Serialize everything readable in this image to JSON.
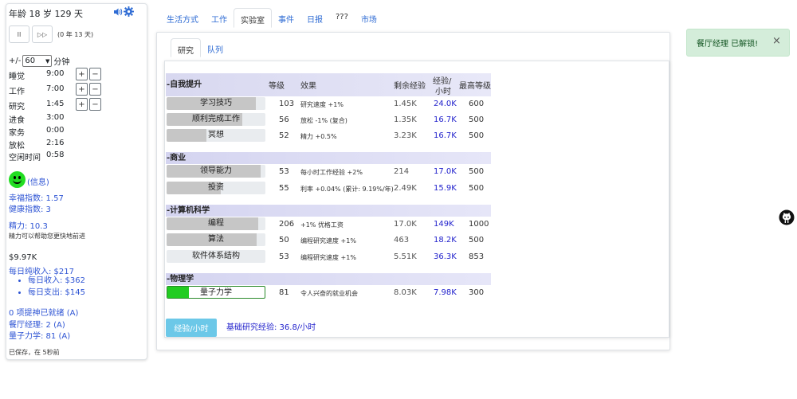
{
  "sidebar": {
    "age": "年龄 18 岁 129 天",
    "sound_icon": "speaker-icon",
    "settings_icon": "gear-icon",
    "pause_label": "II",
    "ff_label": "▷▷",
    "years_days": "(0 年 13 天)",
    "plus_minus": "+/-",
    "minutes_select": "60",
    "minutes_unit": "分钟",
    "schedule": [
      {
        "label": "睡觉",
        "value": "9:00",
        "adjustable": true
      },
      {
        "label": "工作",
        "value": "7:00",
        "adjustable": true
      },
      {
        "label": "研究",
        "value": "1:45",
        "adjustable": true
      },
      {
        "label": "进食",
        "value": "3:00",
        "adjustable": false
      },
      {
        "label": "家务",
        "value": "0:00",
        "adjustable": false
      },
      {
        "label": "放松",
        "value": "2:16",
        "adjustable": false
      },
      {
        "label": "空闲时间",
        "value": "0:58",
        "adjustable": false
      }
    ],
    "plus": "+",
    "minus": "−",
    "info_link": "(信息)",
    "happiness": "幸福指数: 1.57",
    "health": "健康指数: 3",
    "energy": "精力: 10.3",
    "energy_note": "精力可以帮助您更快地前进",
    "money": "$9.97K",
    "daily_net": "每日纯收入: $217",
    "daily_income": "每日收入: $362",
    "daily_expense": "每日支出: $145",
    "ready": "0 项提神已就绪 (A)",
    "restaurant_manager": "餐厅经理: 2 (A)",
    "quantum": "量子力学: 81 (A)",
    "saved": "已保存，在 5秒前"
  },
  "nav": {
    "tabs": [
      "生活方式",
      "工作",
      "实验室",
      "事件",
      "日报",
      "???",
      "市场"
    ],
    "active": "实验室"
  },
  "subnav": {
    "tabs": [
      "研究",
      "队列"
    ],
    "active": "研究"
  },
  "table": {
    "headers": {
      "level": "等级",
      "effect": "效果",
      "remaining": "剩余经验",
      "xph_line1": "经验/",
      "xph_line2": "小时",
      "max": "最高等级"
    },
    "sections": [
      {
        "title": "-自我提升",
        "rows": [
          {
            "name": "学习技巧",
            "progress": 0.9,
            "level": "103",
            "effect": "研究速度 +1%",
            "remaining": "1.45K",
            "xph": "24.0K",
            "max": "600"
          },
          {
            "name": "顺利完成工作",
            "progress": 0.77,
            "level": "56",
            "effect": "放松 -1% (复合)",
            "remaining": "1.35K",
            "xph": "16.7K",
            "max": "500"
          },
          {
            "name": "冥想",
            "progress": 0.4,
            "level": "52",
            "effect": "精力 +0.5%",
            "remaining": "3.23K",
            "xph": "16.7K",
            "max": "500"
          }
        ]
      },
      {
        "title": "-商业",
        "rows": [
          {
            "name": "领导能力",
            "progress": 0.95,
            "level": "53",
            "effect": "每小时工作经验 +2%",
            "remaining": "214",
            "xph": "17.0K",
            "max": "500"
          },
          {
            "name": "投资",
            "progress": 0.55,
            "level": "55",
            "effect": "利率 +0.04% (累计: 9.19%/年)",
            "remaining": "2.49K",
            "xph": "15.9K",
            "max": "500"
          }
        ]
      },
      {
        "title": "-计算机科学",
        "rows": [
          {
            "name": "编程",
            "progress": 0.93,
            "level": "206",
            "effect": "+1% 优格工资",
            "remaining": "17.0K",
            "xph": "149K",
            "max": "1000"
          },
          {
            "name": "算法",
            "progress": 0.91,
            "level": "50",
            "effect": "编程研究速度 +1%",
            "remaining": "463",
            "xph": "18.2K",
            "max": "500"
          },
          {
            "name": "软件体系结构",
            "progress": 0.0,
            "level": "53",
            "effect": "编程研究速度 +1%",
            "remaining": "5.51K",
            "xph": "36.3K",
            "max": "853"
          }
        ]
      },
      {
        "title": "-物理学",
        "rows": [
          {
            "name": "量子力学",
            "progress": 0.22,
            "level": "81",
            "effect": "令人兴奋的就业机会",
            "remaining": "8.03K",
            "xph": "7.98K",
            "max": "300",
            "active": true
          }
        ]
      }
    ]
  },
  "footer": {
    "rate_button": "经验/小时",
    "base_rate": "基础研究经验: 36.8/小时"
  },
  "toast": {
    "text": "餐厅经理 已解锁!",
    "close": "×"
  }
}
